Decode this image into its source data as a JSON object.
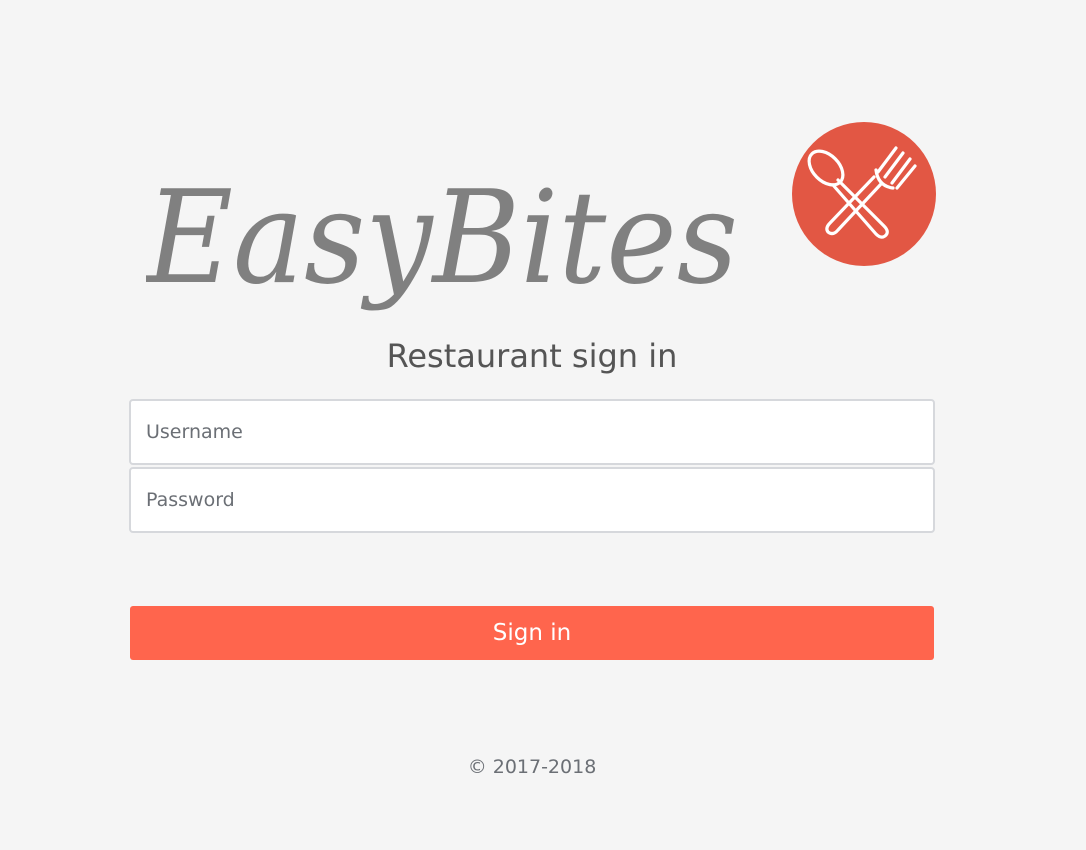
{
  "brand": {
    "name": "EasyBites",
    "logo_icon": "spoon-fork-icon",
    "badge_color": "#e25744",
    "wordmark_color": "#808080"
  },
  "page": {
    "title": "Restaurant sign in"
  },
  "form": {
    "username_placeholder": "Username",
    "username_value": "",
    "password_placeholder": "Password",
    "password_value": "",
    "submit_label": "Sign in",
    "submit_color": "#ff654d"
  },
  "footer": {
    "copyright": "© 2017-2018"
  }
}
